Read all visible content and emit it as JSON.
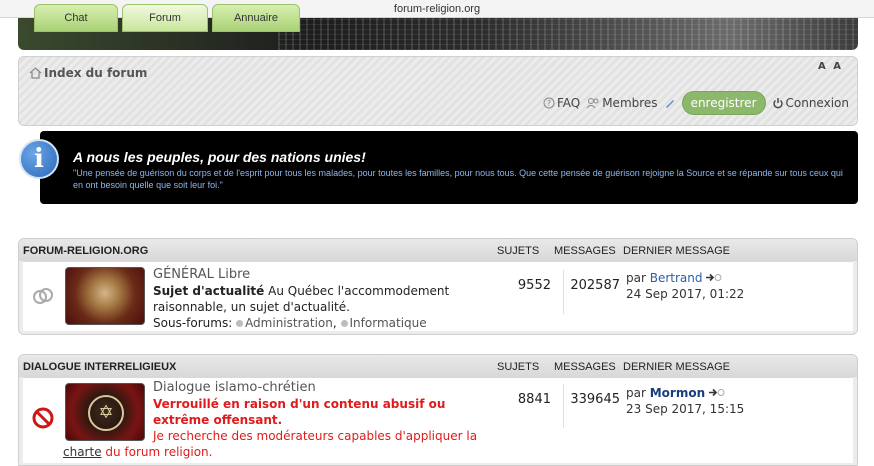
{
  "browser": {
    "url": "forum-religion.org"
  },
  "nav_tabs": [
    {
      "label": "Chat"
    },
    {
      "label": "Forum"
    },
    {
      "label": "Annuaire"
    }
  ],
  "breadcrumb": {
    "label": "Index du forum"
  },
  "font_resize": "A A",
  "header_links": {
    "faq": "FAQ",
    "members": "Membres",
    "register": "enregistrer",
    "login": "Connexion"
  },
  "announcement": {
    "title": "A nous les peuples, pour des nations unies!",
    "text": "\"Une pensée de guérison du corps et de l'esprit pour tous les malades, pour toutes les familles, pour nous tous. Que cette pensée de guérison rejoigne la Source et se répande sur tous ceux qui en ont besoin quelle que soit leur foi.\""
  },
  "columns": {
    "topics": "SUJETS",
    "posts": "MESSAGES",
    "last": "DERNIER MESSAGE"
  },
  "categories": [
    {
      "name": "FORUM-RELIGION.ORG",
      "forum": {
        "title": "GÉNÉRAL Libre",
        "desc_bold": "Sujet d'actualité",
        "desc": " Au Québec l'accommodement raisonnable, un sujet d'actualité.",
        "subforums_label": "Sous-forums: ",
        "subforums": [
          "Administration",
          "Informatique"
        ],
        "topics": "9552",
        "posts": "202587",
        "last_by_label": "par ",
        "last_by": "Bertrand",
        "last_date": "24 Sep 2017, 01:22"
      }
    },
    {
      "name": "DIALOGUE INTERRELIGIEUX",
      "forum": {
        "title": "Dialogue islamo-chrétien",
        "locked_notice": "Verrouillé en raison d'un contenu abusif ou extrême offensant.",
        "desc": "Je recherche des modérateurs capables d'appliquer la",
        "desc_link": "charte",
        "desc_tail": " du forum religion.",
        "topics": "8841",
        "posts": "339645",
        "last_by_label": "par ",
        "last_by": "Mormon",
        "last_date": "23 Sep 2017, 15:15"
      }
    }
  ],
  "colors": {
    "accent_green": "#8bb86a",
    "locked_red": "#e01b1b",
    "announce_bg": "#000000",
    "announce_text": "#8fb7ee"
  }
}
